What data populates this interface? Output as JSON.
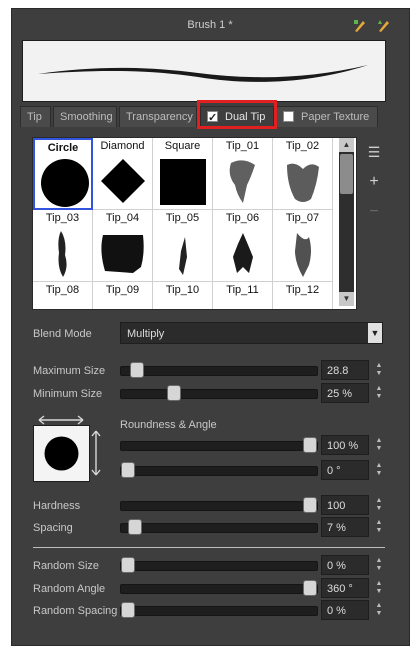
{
  "header": {
    "title": "Brush 1 *"
  },
  "tabs": [
    {
      "label": "Tip"
    },
    {
      "label": "Smoothing"
    },
    {
      "label": "Transparency"
    },
    {
      "label": "Dual Tip",
      "checked": true
    },
    {
      "label": "Paper Texture",
      "checked": false
    }
  ],
  "tips": [
    {
      "name": "Circle",
      "selected": true
    },
    {
      "name": "Diamond"
    },
    {
      "name": "Square"
    },
    {
      "name": "Tip_01"
    },
    {
      "name": "Tip_02"
    },
    {
      "name": "Tip_03"
    },
    {
      "name": "Tip_04"
    },
    {
      "name": "Tip_05"
    },
    {
      "name": "Tip_06"
    },
    {
      "name": "Tip_07"
    },
    {
      "name": "Tip_08"
    },
    {
      "name": "Tip_09"
    },
    {
      "name": "Tip_10"
    },
    {
      "name": "Tip_11"
    },
    {
      "name": "Tip_12"
    }
  ],
  "blend_mode": {
    "label": "Blend Mode",
    "value": "Multiply"
  },
  "max_size": {
    "label": "Maximum Size",
    "value": "28.8",
    "level": 0.05
  },
  "min_size": {
    "label": "Minimum Size",
    "value": "25 %",
    "level": 0.25
  },
  "roundness": {
    "label": "Roundness & Angle",
    "roundness": "100 %",
    "roundness_level": 1.0,
    "angle": "0 °",
    "angle_level": 0.0
  },
  "hardness": {
    "label": "Hardness",
    "value": "100",
    "level": 1.0
  },
  "spacing": {
    "label": "Spacing",
    "value": "7 %",
    "level": 0.04
  },
  "random_size": {
    "label": "Random Size",
    "value": "0 %",
    "level": 0.0
  },
  "random_angle": {
    "label": "Random Angle",
    "value": "360 °",
    "level": 1.0
  },
  "random_spacing": {
    "label": "Random Spacing",
    "value": "0 %",
    "level": 0.0
  },
  "colors": {
    "selection_border": "#3355dd",
    "highlight": "#e02020"
  }
}
